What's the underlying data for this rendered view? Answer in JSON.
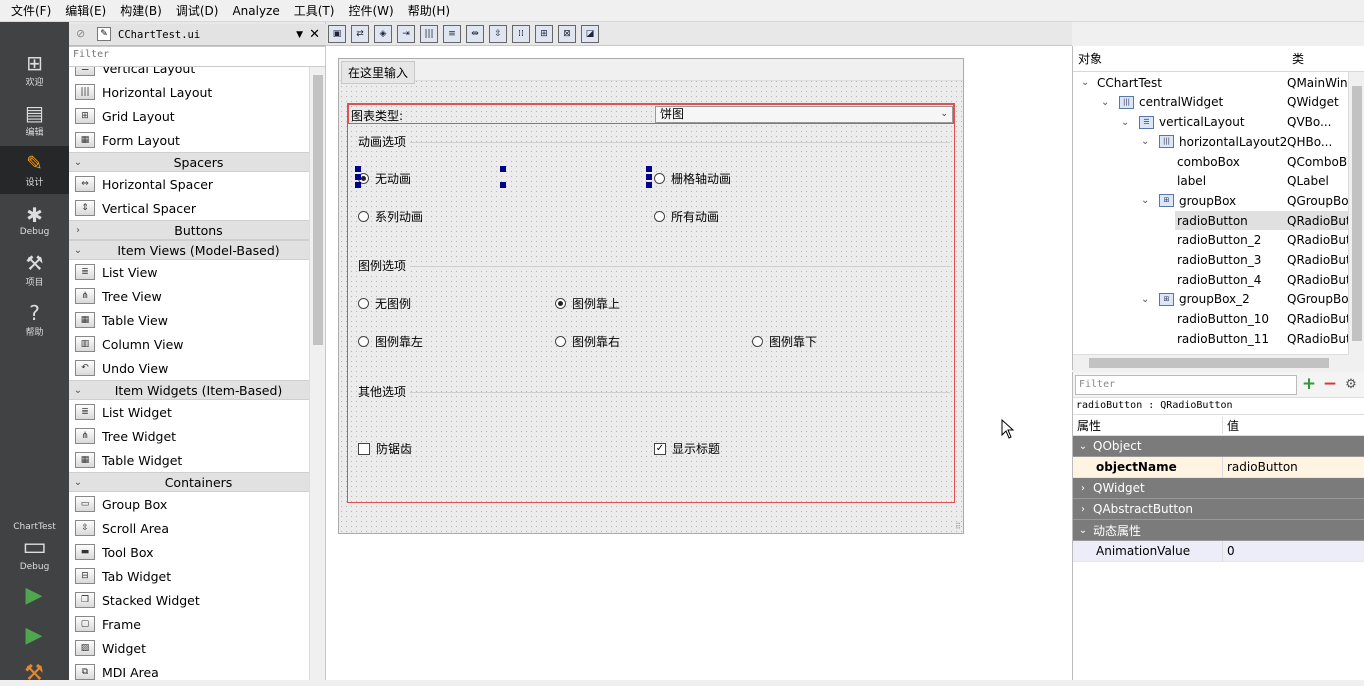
{
  "menu": [
    "文件(F)",
    "编辑(E)",
    "构建(B)",
    "调试(D)",
    "Analyze",
    "工具(T)",
    "控件(W)",
    "帮助(H)"
  ],
  "modes": [
    {
      "label": "欢迎",
      "icon": "grid-icon"
    },
    {
      "label": "编辑",
      "icon": "document-icon"
    },
    {
      "label": "设计",
      "icon": "pencil-icon"
    },
    {
      "label": "Debug",
      "icon": "bug-icon"
    },
    {
      "label": "项目",
      "icon": "wrench-icon"
    },
    {
      "label": "帮助",
      "icon": "help-icon"
    }
  ],
  "kit": {
    "project": "ChartTest",
    "build": "Debug"
  },
  "document": {
    "filename": "CChartTest.ui"
  },
  "widgetbox": {
    "filter_placeholder": "Filter",
    "items": [
      {
        "type": "item",
        "label": "Vertical Layout",
        "icon": "vertical-layout-icon"
      },
      {
        "type": "item",
        "label": "Horizontal Layout",
        "icon": "horizontal-layout-icon"
      },
      {
        "type": "item",
        "label": "Grid Layout",
        "icon": "grid-layout-icon"
      },
      {
        "type": "item",
        "label": "Form Layout",
        "icon": "form-layout-icon"
      },
      {
        "type": "category",
        "label": "Spacers",
        "expanded": true
      },
      {
        "type": "item",
        "label": "Horizontal Spacer",
        "icon": "horizontal-spacer-icon"
      },
      {
        "type": "item",
        "label": "Vertical Spacer",
        "icon": "vertical-spacer-icon"
      },
      {
        "type": "category",
        "label": "Buttons",
        "expanded": false
      },
      {
        "type": "category",
        "label": "Item Views (Model-Based)",
        "expanded": true
      },
      {
        "type": "item",
        "label": "List View",
        "icon": "list-view-icon"
      },
      {
        "type": "item",
        "label": "Tree View",
        "icon": "tree-view-icon"
      },
      {
        "type": "item",
        "label": "Table View",
        "icon": "table-view-icon"
      },
      {
        "type": "item",
        "label": "Column View",
        "icon": "column-view-icon"
      },
      {
        "type": "item",
        "label": "Undo View",
        "icon": "undo-view-icon"
      },
      {
        "type": "category",
        "label": "Item Widgets (Item-Based)",
        "expanded": true
      },
      {
        "type": "item",
        "label": "List Widget",
        "icon": "list-widget-icon"
      },
      {
        "type": "item",
        "label": "Tree Widget",
        "icon": "tree-widget-icon"
      },
      {
        "type": "item",
        "label": "Table Widget",
        "icon": "table-widget-icon"
      },
      {
        "type": "category",
        "label": "Containers",
        "expanded": true
      },
      {
        "type": "item",
        "label": "Group Box",
        "icon": "group-box-icon"
      },
      {
        "type": "item",
        "label": "Scroll Area",
        "icon": "scroll-area-icon"
      },
      {
        "type": "item",
        "label": "Tool Box",
        "icon": "tool-box-icon"
      },
      {
        "type": "item",
        "label": "Tab Widget",
        "icon": "tab-widget-icon"
      },
      {
        "type": "item",
        "label": "Stacked Widget",
        "icon": "stacked-widget-icon"
      },
      {
        "type": "item",
        "label": "Frame",
        "icon": "frame-icon"
      },
      {
        "type": "item",
        "label": "Widget",
        "icon": "widget-icon"
      },
      {
        "type": "item",
        "label": "MDI Area",
        "icon": "mdi-area-icon"
      }
    ]
  },
  "form": {
    "menu_placeholder": "在这里输入",
    "chart_type_label": "图表类型:",
    "chart_type_value": "饼图",
    "animation_group": {
      "title": "动画选项",
      "options": [
        {
          "label": "无动画",
          "checked": true
        },
        {
          "label": "栅格轴动画",
          "checked": false
        },
        {
          "label": "系列动画",
          "checked": false
        },
        {
          "label": "所有动画",
          "checked": false
        }
      ]
    },
    "legend_group": {
      "title": "图例选项",
      "options": [
        {
          "label": "无图例",
          "checked": false
        },
        {
          "label": "图例靠上",
          "checked": true
        },
        {
          "label": "图例靠左",
          "checked": false
        },
        {
          "label": "图例靠右",
          "checked": false
        },
        {
          "label": "图例靠下",
          "checked": false
        }
      ]
    },
    "other_group": {
      "title": "其他选项",
      "options": [
        {
          "label": "防锯齿",
          "checked": false
        },
        {
          "label": "显示标题",
          "checked": true
        }
      ]
    }
  },
  "object_inspector": {
    "col_object": "对象",
    "col_class": "类",
    "rows": [
      {
        "name": "CChartTest",
        "class": "QMainWin",
        "depth": 0,
        "arrow": "down",
        "icon": ""
      },
      {
        "name": "centralWidget",
        "class": "QWidget",
        "depth": 1,
        "arrow": "down",
        "icon": "hbox-layout-icon"
      },
      {
        "name": "verticalLayout",
        "class": "QVBo...",
        "depth": 2,
        "arrow": "down",
        "icon": "vbox-layout-icon"
      },
      {
        "name": "horizontalLayout2",
        "class": "QHBo...",
        "depth": 3,
        "arrow": "down",
        "icon": "hbox-layout-icon"
      },
      {
        "name": "comboBox",
        "class": "QComboB",
        "depth": 4,
        "arrow": "",
        "icon": ""
      },
      {
        "name": "label",
        "class": "QLabel",
        "depth": 4,
        "arrow": "",
        "icon": ""
      },
      {
        "name": "groupBox",
        "class": "QGroupBo",
        "depth": 3,
        "arrow": "down",
        "icon": "grid-layout-icon"
      },
      {
        "name": "radioButton",
        "class": "QRadioBut",
        "depth": 4,
        "arrow": "",
        "icon": "",
        "selected": true
      },
      {
        "name": "radioButton_2",
        "class": "QRadioBut",
        "depth": 4,
        "arrow": "",
        "icon": ""
      },
      {
        "name": "radioButton_3",
        "class": "QRadioBut",
        "depth": 4,
        "arrow": "",
        "icon": ""
      },
      {
        "name": "radioButton_4",
        "class": "QRadioBut",
        "depth": 4,
        "arrow": "",
        "icon": ""
      },
      {
        "name": "groupBox_2",
        "class": "QGroupBo",
        "depth": 3,
        "arrow": "down",
        "icon": "grid-layout-icon"
      },
      {
        "name": "radioButton_10",
        "class": "QRadioBut",
        "depth": 4,
        "arrow": "",
        "icon": ""
      },
      {
        "name": "radioButton_11",
        "class": "QRadioBut",
        "depth": 4,
        "arrow": "",
        "icon": ""
      }
    ]
  },
  "property_editor": {
    "filter_placeholder": "Filter",
    "object_line": "radioButton : QRadioButton",
    "col_property": "属性",
    "col_value": "值",
    "rows": [
      {
        "type": "category",
        "label": "QObject",
        "expanded": true
      },
      {
        "type": "prop",
        "name": "objectName",
        "value": "radioButton",
        "style": "obj"
      },
      {
        "type": "category",
        "label": "QWidget",
        "expanded": false
      },
      {
        "type": "category",
        "label": "QAbstractButton",
        "expanded": false
      },
      {
        "type": "category",
        "label": "动态属性",
        "expanded": true
      },
      {
        "type": "prop",
        "name": "AnimationValue",
        "value": "0",
        "style": "dyn"
      }
    ]
  }
}
